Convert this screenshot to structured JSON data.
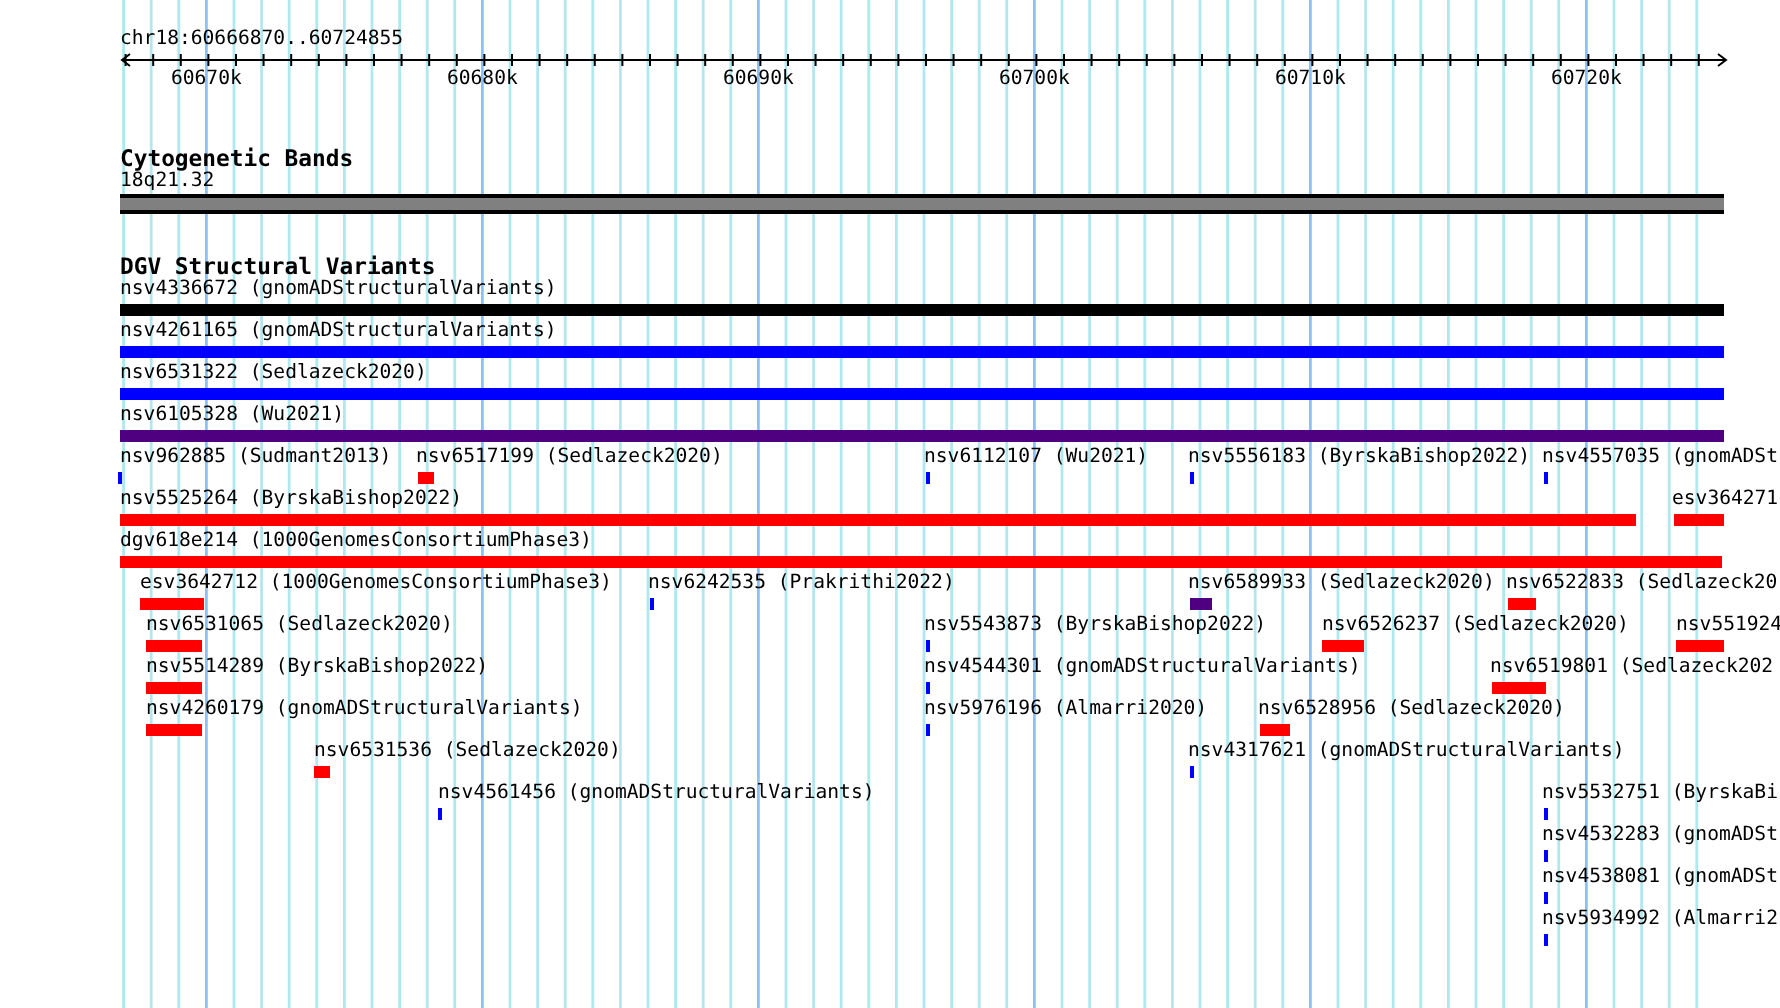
{
  "location": "chr18:60666870..60724855",
  "ruler": {
    "ticks": [
      "60670k",
      "60680k",
      "60690k",
      "60700k",
      "60710k",
      "60720k"
    ]
  },
  "band_track": {
    "title": "Cytogenetic Bands",
    "band": {
      "label": "18q21.32",
      "color": "#808080"
    }
  },
  "variant_track": {
    "title": "DGV Structural Variants",
    "features": [
      {
        "label": "nsv4336672 (gnomADStructuralVariants)",
        "color": "#000000"
      },
      {
        "label": "nsv4261165 (gnomADStructuralVariants)",
        "color": "#0000ff"
      },
      {
        "label": "nsv6531322 (Sedlazeck2020)",
        "color": "#0000ff"
      },
      {
        "label": "nsv6105328 (Wu2021)",
        "color": "#4f0080"
      },
      {
        "label": "nsv962885 (Sudmant2013)",
        "color": "#0000ff"
      },
      {
        "label": "nsv6517199 (Sedlazeck2020)",
        "color": "#ff0000"
      },
      {
        "label": "nsv6112107 (Wu2021)",
        "color": "#0000ff"
      },
      {
        "label": "nsv5556183 (ByrskaBishop2022)",
        "color": "#0000ff"
      },
      {
        "label": "nsv4557035 (gnomADSt",
        "color": "#0000ff"
      },
      {
        "label": "nsv5525264 (ByrskaBishop2022)",
        "color": "#ff0000"
      },
      {
        "label": "esv364271",
        "color": "#ff0000"
      },
      {
        "label": "dgv618e214 (1000GenomesConsortiumPhase3)",
        "color": "#ff0000"
      },
      {
        "label": "esv3642712 (1000GenomesConsortiumPhase3)",
        "color": "#ff0000"
      },
      {
        "label": "nsv6242535 (Prakrithi2022)",
        "color": "#0000ff"
      },
      {
        "label": "nsv6589933 (Sedlazeck2020)",
        "color": "#4f0080"
      },
      {
        "label": "nsv6522833 (Sedlazeck20",
        "color": "#ff0000"
      },
      {
        "label": "nsv6531065 (Sedlazeck2020)",
        "color": "#ff0000"
      },
      {
        "label": "nsv5543873 (ByrskaBishop2022)",
        "color": "#0000ff"
      },
      {
        "label": "nsv6526237 (Sedlazeck2020)",
        "color": "#ff0000"
      },
      {
        "label": "nsv551924",
        "color": "#ff0000"
      },
      {
        "label": "nsv5514289 (ByrskaBishop2022)",
        "color": "#ff0000"
      },
      {
        "label": "nsv4544301 (gnomADStructuralVariants)",
        "color": "#0000ff"
      },
      {
        "label": "nsv6519801 (Sedlazeck202",
        "color": "#ff0000"
      },
      {
        "label": "nsv4260179 (gnomADStructuralVariants)",
        "color": "#ff0000"
      },
      {
        "label": "nsv5976196 (Almarri2020)",
        "color": "#0000ff"
      },
      {
        "label": "nsv6528956 (Sedlazeck2020)",
        "color": "#ff0000"
      },
      {
        "label": "nsv6531536 (Sedlazeck2020)",
        "color": "#ff0000"
      },
      {
        "label": "nsv4317621 (gnomADStructuralVariants)",
        "color": "#0000ff"
      },
      {
        "label": "nsv4561456 (gnomADStructuralVariants)",
        "color": "#0000ff"
      },
      {
        "label": "nsv5532751 (ByrskaBi",
        "color": "#0000ff"
      },
      {
        "label": "nsv4532283 (gnomADSt",
        "color": "#0000ff"
      },
      {
        "label": "nsv4538081 (gnomADSt",
        "color": "#0000ff"
      },
      {
        "label": "nsv5934992 (Almarri2",
        "color": "#0000ff"
      }
    ]
  }
}
